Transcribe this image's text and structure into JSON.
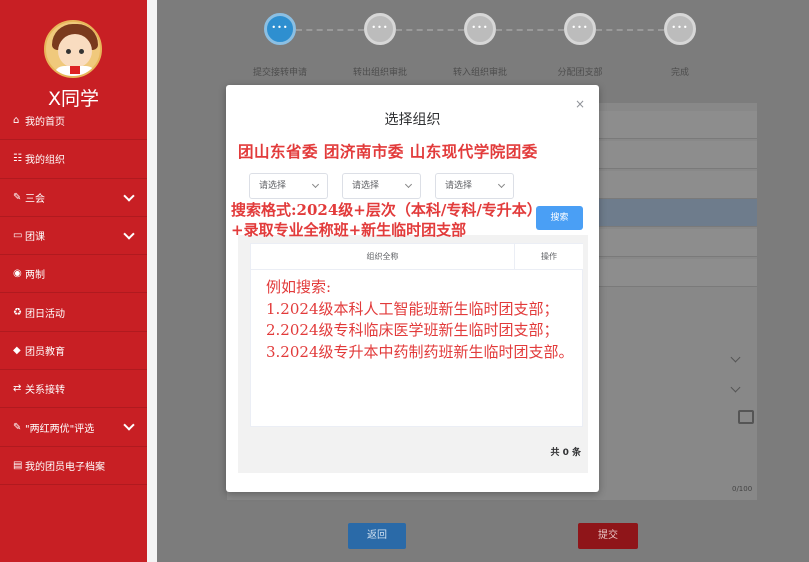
{
  "sidebar": {
    "user_name": "X同学",
    "items": [
      {
        "icon": "⌂",
        "label": "我的首页",
        "has_chevron": false
      },
      {
        "icon": "☷",
        "label": "我的组织",
        "has_chevron": false
      },
      {
        "icon": "✎",
        "label": "三会",
        "has_chevron": true
      },
      {
        "icon": "▭",
        "label": "团课",
        "has_chevron": true
      },
      {
        "icon": "◉",
        "label": "两制",
        "has_chevron": false
      },
      {
        "icon": "♻",
        "label": "团日活动",
        "has_chevron": false
      },
      {
        "icon": "◆",
        "label": "团员教育",
        "has_chevron": false
      },
      {
        "icon": "⇄",
        "label": "关系接转",
        "has_chevron": false
      },
      {
        "icon": "✎",
        "label": "\"两红两优\"评选",
        "has_chevron": true
      },
      {
        "icon": "▤",
        "label": "我的团员电子档案",
        "has_chevron": false
      }
    ]
  },
  "steps": [
    {
      "label": "提交接转申请",
      "active": true
    },
    {
      "label": "转出组织审批",
      "active": false
    },
    {
      "label": "转入组织审批",
      "active": false
    },
    {
      "label": "分配团支部",
      "active": false
    },
    {
      "label": "完成",
      "active": false
    }
  ],
  "form": {
    "char_count": "0/100",
    "back_label": "返回",
    "submit_label": "提交"
  },
  "modal": {
    "title": "选择组织",
    "close_icon": "×",
    "selects": [
      "请选择",
      "请选择",
      "请选择"
    ],
    "search_label": "搜索",
    "table_headers": {
      "name": "组织全称",
      "actions": "操作"
    },
    "total": "共 0 条"
  },
  "annotations": {
    "org_line": "团山东省委 团济南市委 山东现代学院团委",
    "search_format": "搜索格式:2024级+层次（本科/专科/专升本）+录取专业全称班+新生临时团支部",
    "example_title": "例如搜索:",
    "example_lines": [
      "1.2024级本科人工智能班新生临时团支部；",
      "2.2024级专科临床医学班新生临时团支部；",
      "3.2024级专升本中药制药班新生临时团支部。"
    ]
  },
  "colors": {
    "sidebar_red": "#c81f24",
    "primary_blue": "#4a9ff5",
    "annotation_red": "#e23b3b"
  }
}
